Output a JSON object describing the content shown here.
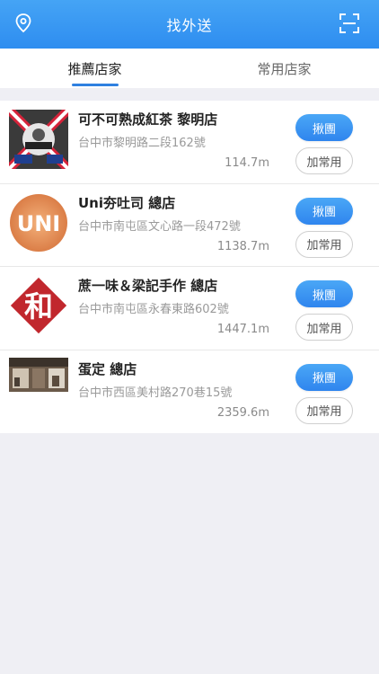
{
  "header": {
    "title": "找外送",
    "left_icon": "location-pin-icon",
    "right_icon": "scan-icon"
  },
  "tabs": [
    {
      "label": "推薦店家",
      "active": true
    },
    {
      "label": "常用店家",
      "active": false
    }
  ],
  "colors": {
    "accent": "#2f8cf0",
    "header_top": "#45a4f5",
    "tab_indicator": "#2f80e0"
  },
  "stores": [
    {
      "name": "可不可熟成紅茶 黎明店",
      "address": "台中市黎明路二段162號",
      "distance": "114.7m",
      "primary_label": "揪團",
      "secondary_label": "加常用",
      "logo_icon": "kebuke-logo"
    },
    {
      "name": "Uni夯吐司 總店",
      "address": "台中市南屯區文心路一段472號",
      "distance": "1138.7m",
      "primary_label": "揪團",
      "secondary_label": "加常用",
      "logo_icon": "uni-logo"
    },
    {
      "name": "蔗一味＆梁記手作 總店",
      "address": "台中市南屯區永春東路602號",
      "distance": "1447.1m",
      "primary_label": "揪團",
      "secondary_label": "加常用",
      "logo_icon": "he-seal-logo"
    },
    {
      "name": "蛋定 總店",
      "address": "台中市西區美村路270巷15號",
      "distance": "2359.6m",
      "primary_label": "揪團",
      "secondary_label": "加常用",
      "logo_icon": "store-photo"
    }
  ]
}
